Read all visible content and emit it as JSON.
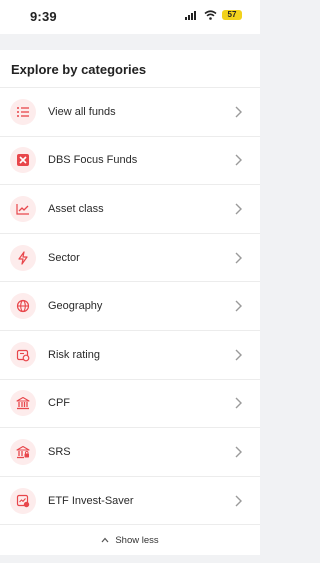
{
  "status_bar": {
    "time": "9:39",
    "battery": "57"
  },
  "section": {
    "title": "Explore by categories"
  },
  "categories": [
    {
      "label": "View all funds",
      "icon": "list-icon"
    },
    {
      "label": "DBS Focus Funds",
      "icon": "focus-badge-icon"
    },
    {
      "label": "Asset class",
      "icon": "trend-chart-icon"
    },
    {
      "label": "Sector",
      "icon": "lightning-icon"
    },
    {
      "label": "Geography",
      "icon": "globe-icon"
    },
    {
      "label": "Risk rating",
      "icon": "risk-rating-icon"
    },
    {
      "label": "CPF",
      "icon": "bank-icon"
    },
    {
      "label": "SRS",
      "icon": "bank-lock-icon"
    },
    {
      "label": "ETF Invest-Saver",
      "icon": "etf-saver-icon"
    }
  ],
  "footer": {
    "show_less": "Show less"
  },
  "colors": {
    "accent": "#e8464b",
    "icon_bg": "#fdecec"
  }
}
